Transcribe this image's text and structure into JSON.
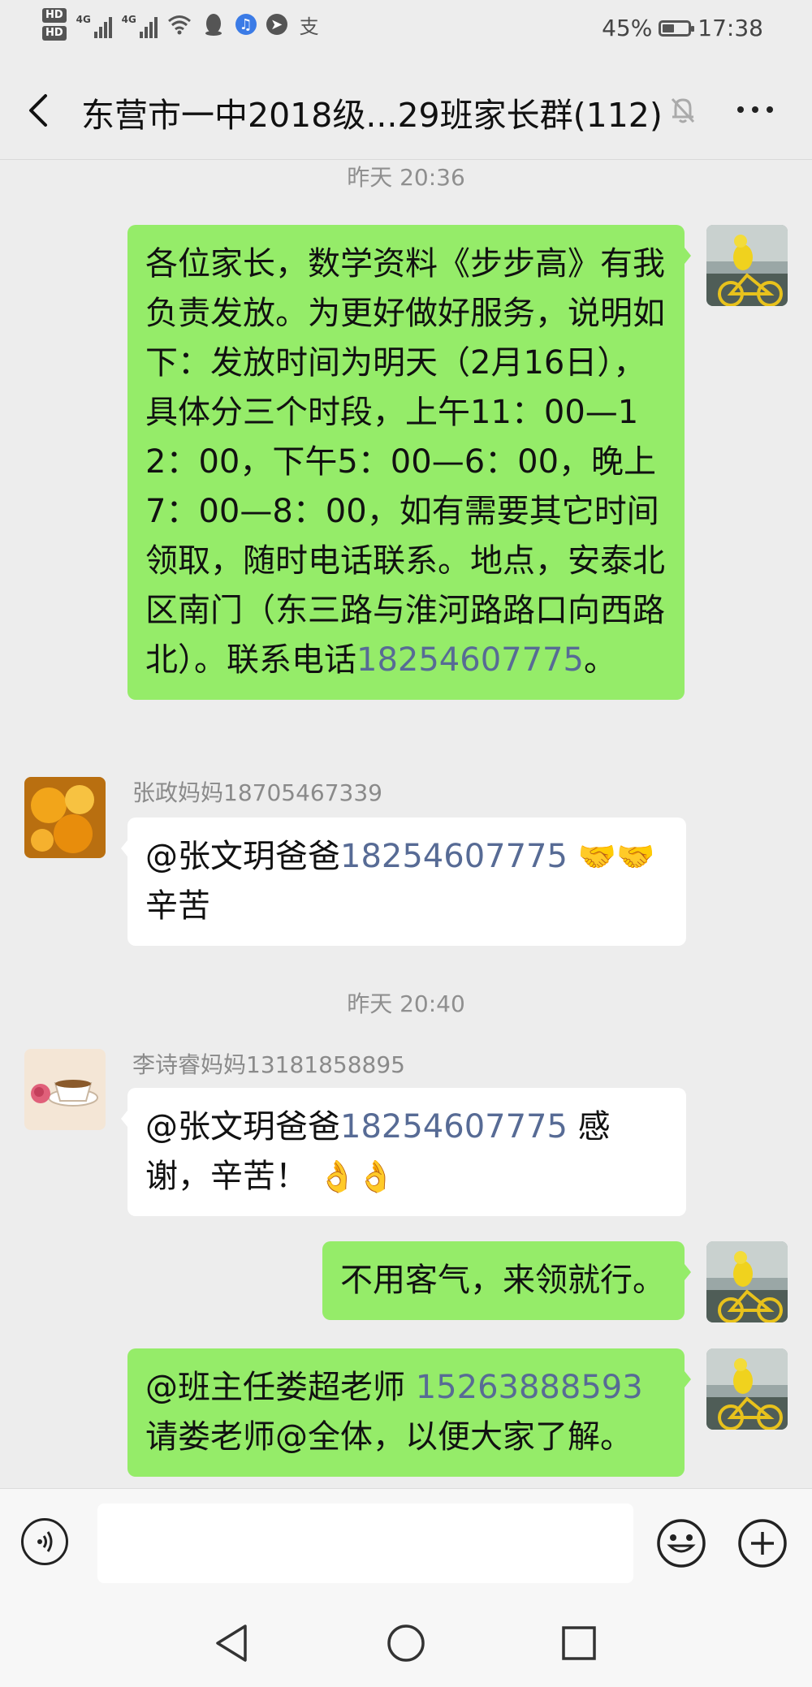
{
  "status_bar": {
    "hd1": "HD",
    "hd2": "HD",
    "net1": "4G",
    "net2": "4G",
    "battery_text": "45%",
    "battery_level": 0.45,
    "time": "17:38",
    "icons": [
      "signal-icon",
      "wifi-icon",
      "qq-icon",
      "music-icon",
      "location-icon",
      "alipay-icon"
    ],
    "alipay_glyph": "支"
  },
  "nav": {
    "title": "东营市一中2018级...29班家长群(112)",
    "icons": [
      "back-icon",
      "mute-bell-icon",
      "more-icon"
    ]
  },
  "messages": {
    "time1": "昨天 20:36",
    "msg1": {
      "text": "各位家长，数学资料《步步高》有我负责发放。为更好做好服务，说明如下：发放时间为明天（2月16日），具体分三个时段，上午11：00—12：00，下午5：00—6：00，晚上7：00—8：00，如有需要其它时间领取，随时电话联系。地点，安泰北区南门（东三路与淮河路路口向西路北）。联系电话",
      "phone": "18254607775",
      "end": "。"
    },
    "msg2": {
      "sender": "张政妈妈18705467339",
      "prefix": "@张文玥爸爸",
      "phone": "18254607775",
      "emoji": "🤝🤝",
      "suffix": "辛苦"
    },
    "time2": "昨天 20:40",
    "msg3": {
      "sender": "李诗睿妈妈13181858895",
      "prefix": "@张文玥爸爸",
      "phone": "18254607775",
      "middle": " 感谢，辛苦！",
      "emoji": "👌👌"
    },
    "msg4": {
      "text": "不用客气，来领就行。"
    },
    "msg5": {
      "prefix": "@班主任娄超老师",
      "phone": "15263888593",
      "suffix": "请娄老师@全体，以便大家了解。"
    }
  },
  "input_bar": {
    "placeholder": "",
    "icons": [
      "voice-icon",
      "emoji-icon",
      "plus-icon"
    ]
  },
  "system_nav": {
    "icons": [
      "back-triangle-icon",
      "home-circle-icon",
      "recents-square-icon"
    ]
  },
  "colors": {
    "my_bubble": "#95ec69",
    "other_bubble": "#ffffff",
    "link": "#576b95",
    "background": "#ededed"
  }
}
